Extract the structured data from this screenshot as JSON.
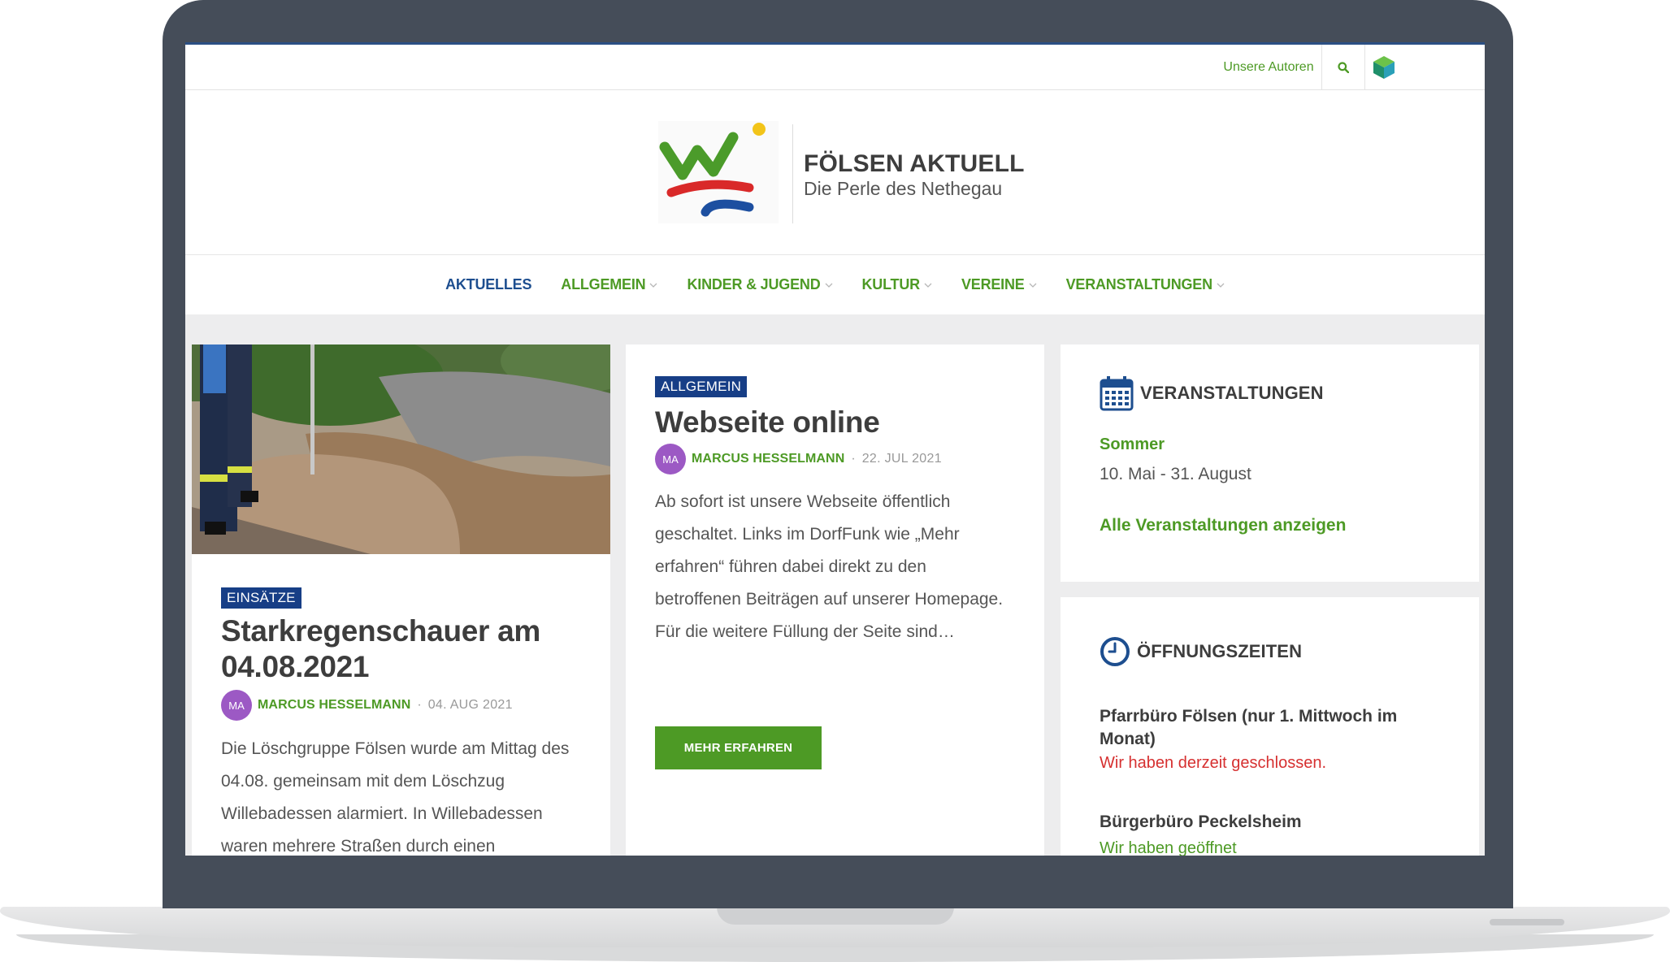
{
  "topbar": {
    "authors_link": "Unsere Autoren"
  },
  "site": {
    "title": "FÖLSEN AKTUELL",
    "tagline": "Die Perle des Nethegau"
  },
  "nav": {
    "items": [
      {
        "label": "AKTUELLES",
        "dropdown": false
      },
      {
        "label": "ALLGEMEIN",
        "dropdown": true
      },
      {
        "label": "KINDER & JUGEND",
        "dropdown": true
      },
      {
        "label": "KULTUR",
        "dropdown": true
      },
      {
        "label": "VEREINE",
        "dropdown": true
      },
      {
        "label": "VERANSTALTUNGEN",
        "dropdown": true
      }
    ]
  },
  "posts": [
    {
      "category": "EINSÄTZE",
      "title": "Starkregenschauer am 04.08.2021",
      "avatar_initials": "MA",
      "author": "MARCUS HESSELMANN",
      "separator": "·",
      "date": "04. AUG 2021",
      "excerpt": "Die Löschgruppe Fölsen wurde am Mittag des 04.08. gemeinsam mit dem Löschzug Willebadessen alarmiert. In Willebadessen waren mehrere Straßen durch einen"
    },
    {
      "category": "ALLGEMEIN",
      "title": "Webseite online",
      "avatar_initials": "MA",
      "author": "MARCUS HESSELMANN",
      "separator": "·",
      "date": "22. JUL 2021",
      "excerpt": "Ab sofort ist unsere Webseite öffentlich geschaltet. Links im DorfFunk wie „Mehr erfahren“ führen dabei direkt zu den betroffenen Beiträgen auf unserer Homepage. Für die weitere Füllung der Seite sind…",
      "button": "MEHR ERFAHREN"
    }
  ],
  "events_widget": {
    "title": "VERANSTALTUNGEN",
    "event_name": "Sommer",
    "event_dates": "10. Mai - 31. August",
    "all_link": "Alle Veranstaltungen anzeigen"
  },
  "hours_widget": {
    "title": "ÖFFNUNGSZEITEN",
    "offices": [
      {
        "name": "Pfarrbüro Fölsen (nur 1. Mittwoch im Monat)",
        "status": "Wir haben derzeit geschlossen."
      },
      {
        "name": "Bürgerbüro Peckelsheim",
        "status": "Wir haben geöffnet"
      }
    ]
  },
  "colors": {
    "brand_green": "#4d9a25",
    "brand_blue": "#173e86",
    "closed_red": "#d63030",
    "avatar_purple": "#9c59c4"
  }
}
